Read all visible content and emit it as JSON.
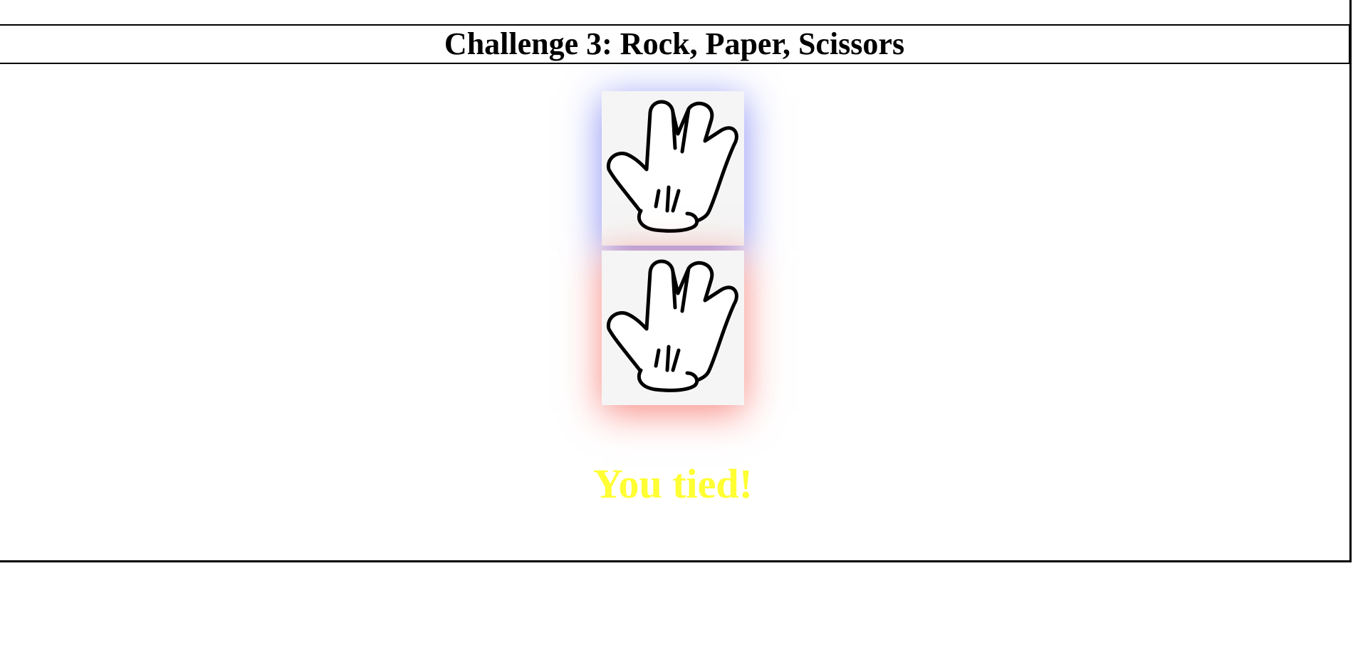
{
  "header": {
    "title": "Challenge 3: Rock, Paper, Scissors"
  },
  "choices": {
    "player": {
      "icon": "paper-hand-icon",
      "glow_color": "#2532e9"
    },
    "bot": {
      "icon": "paper-hand-icon",
      "glow_color": "#f32618"
    }
  },
  "result": {
    "message": "You tied!",
    "color": "#ffff33"
  }
}
